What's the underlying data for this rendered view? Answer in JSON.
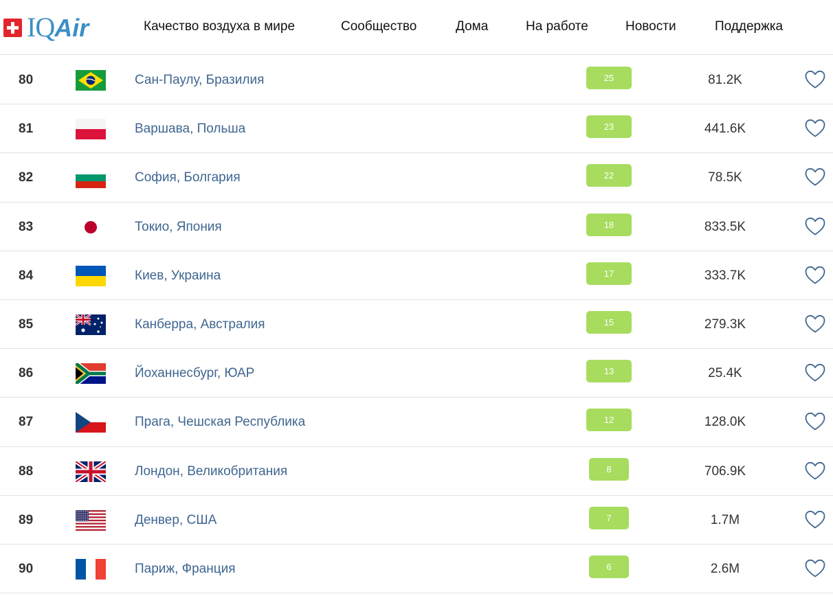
{
  "logo": {
    "iq": "IQ",
    "air": "Air"
  },
  "nav": [
    "Качество воздуха в мире",
    "Сообщество",
    "Дома",
    "На работе",
    "Новости",
    "Поддержка"
  ],
  "colors": {
    "accent": "#3c8fc7",
    "aqi_good": "#a7dc5e",
    "city_link": "#3f6690"
  },
  "rows": [
    {
      "rank": "80",
      "flag": "brazil",
      "city": "Сан-Паулу, Бразилия",
      "aqi": "25",
      "followers": "81.2K"
    },
    {
      "rank": "81",
      "flag": "poland",
      "city": "Варшава, Польша",
      "aqi": "23",
      "followers": "441.6K"
    },
    {
      "rank": "82",
      "flag": "bulgaria",
      "city": "София, Болгария",
      "aqi": "22",
      "followers": "78.5K"
    },
    {
      "rank": "83",
      "flag": "japan",
      "city": "Токио, Япония",
      "aqi": "18",
      "followers": "833.5K"
    },
    {
      "rank": "84",
      "flag": "ukraine",
      "city": "Киев, Украина",
      "aqi": "17",
      "followers": "333.7K"
    },
    {
      "rank": "85",
      "flag": "australia",
      "city": "Канберра, Австралия",
      "aqi": "15",
      "followers": "279.3K"
    },
    {
      "rank": "86",
      "flag": "south-africa",
      "city": "Йоханнесбург, ЮАР",
      "aqi": "13",
      "followers": "25.4K"
    },
    {
      "rank": "87",
      "flag": "czech-republic",
      "city": "Прага, Чешская Республика",
      "aqi": "12",
      "followers": "128.0K"
    },
    {
      "rank": "88",
      "flag": "united-kingdom",
      "city": "Лондон, Великобритания",
      "aqi": "8",
      "followers": "706.9K"
    },
    {
      "rank": "89",
      "flag": "usa",
      "city": "Денвер, США",
      "aqi": "7",
      "followers": "1.7M"
    },
    {
      "rank": "90",
      "flag": "france",
      "city": "Париж, Франция",
      "aqi": "6",
      "followers": "2.6M"
    }
  ]
}
